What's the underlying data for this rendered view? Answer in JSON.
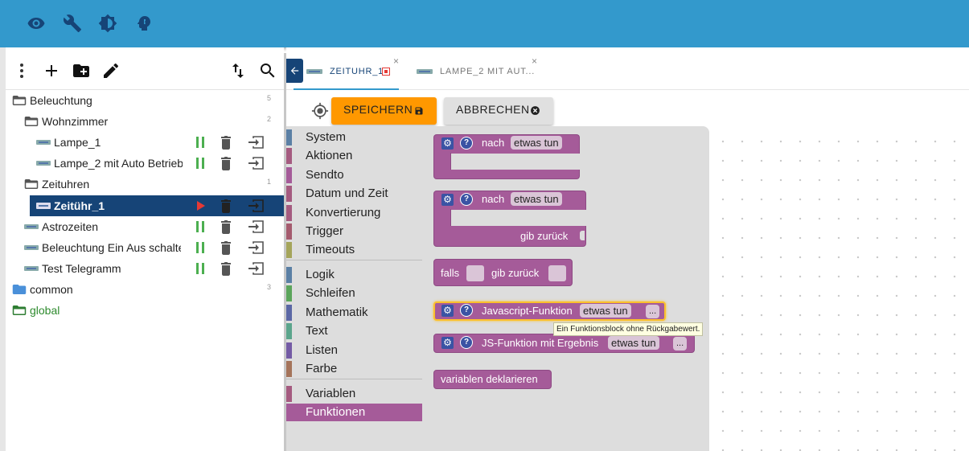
{
  "colors": {
    "topbar": "#3399cc",
    "selected_row": "#164477",
    "save_button": "#ff9800",
    "funktionen": "#a55b99",
    "run_icon": "#e53935",
    "pause_icon": "#4caf50"
  },
  "topbar": {
    "icons": [
      "eye-icon",
      "wrench-icon",
      "brightness-icon",
      "head-icon"
    ]
  },
  "sidebar": {
    "toolbar_icons": [
      "more-vert-icon",
      "add-icon",
      "create-folder-icon",
      "edit-icon",
      "sort-icon",
      "search-icon"
    ],
    "tree": [
      {
        "label": "Beleuchtung",
        "type": "folder-open",
        "count": "5"
      },
      {
        "label": "Wohnzimmer",
        "type": "folder-open",
        "count": "2"
      },
      {
        "label": "Lampe_1",
        "type": "script",
        "state": "running"
      },
      {
        "label": "Lampe_2 mit Auto Betrieb",
        "type": "script",
        "state": "running"
      },
      {
        "label": "Zeituhren",
        "type": "folder-open",
        "count": "1"
      },
      {
        "label": "Zeitühr_1",
        "type": "script",
        "state": "stopped"
      },
      {
        "label": "Astrozeiten",
        "type": "script",
        "state": "running"
      },
      {
        "label": "Beleuchtung Ein Aus schalter",
        "type": "script",
        "state": "running"
      },
      {
        "label": "Test Telegramm",
        "type": "script",
        "state": "running"
      },
      {
        "label": "common",
        "type": "folder",
        "count": "3"
      },
      {
        "label": "global",
        "type": "folder-open",
        "count": ""
      }
    ]
  },
  "tabs": [
    {
      "label": "ZEITUHR_1",
      "close": "×",
      "active": true
    },
    {
      "label": "LAMPE_2 MIT AUT...",
      "close": "×",
      "active": false
    }
  ],
  "actions": {
    "save": "SPEICHERN",
    "cancel": "ABBRECHEN"
  },
  "toolbox": {
    "categories": [
      {
        "label": "System",
        "color": "#5b80a5"
      },
      {
        "label": "Aktionen",
        "color": "#a55b80"
      },
      {
        "label": "Sendto",
        "color": "#a55b99"
      },
      {
        "label": "Datum und Zeit",
        "color": "#a55b80"
      },
      {
        "label": "Konvertierung",
        "color": "#a55b80"
      },
      {
        "label": "Trigger",
        "color": "#a55b6e"
      },
      {
        "label": "Timeouts",
        "color": "#a5a55b"
      },
      {
        "label": "Logik",
        "color": "#5b80a5"
      },
      {
        "label": "Schleifen",
        "color": "#5ba55b"
      },
      {
        "label": "Mathematik",
        "color": "#5b67a5"
      },
      {
        "label": "Text",
        "color": "#5ba58c"
      },
      {
        "label": "Listen",
        "color": "#745ba5"
      },
      {
        "label": "Farbe",
        "color": "#a5745b"
      },
      {
        "label": "Variablen",
        "color": "#a55b80"
      },
      {
        "label": "Funktionen",
        "color": "#a55b99"
      }
    ]
  },
  "blocks": {
    "b1": {
      "nach": "nach",
      "field": "etwas tun"
    },
    "b2": {
      "nach": "nach",
      "field": "etwas tun",
      "return": "gib zurück"
    },
    "b3": {
      "falls": "falls",
      "return": "gib zurück"
    },
    "b4": {
      "label": "Javascript-Funktion",
      "field": "etwas tun",
      "dots": "..."
    },
    "b5": {
      "label": "JS-Funktion mit Ergebnis",
      "field": "etwas tun",
      "dots": "..."
    },
    "b6": {
      "label": "variablen deklarieren"
    },
    "tooltip": "Ein Funktionsblock ohne Rückgabewert."
  }
}
